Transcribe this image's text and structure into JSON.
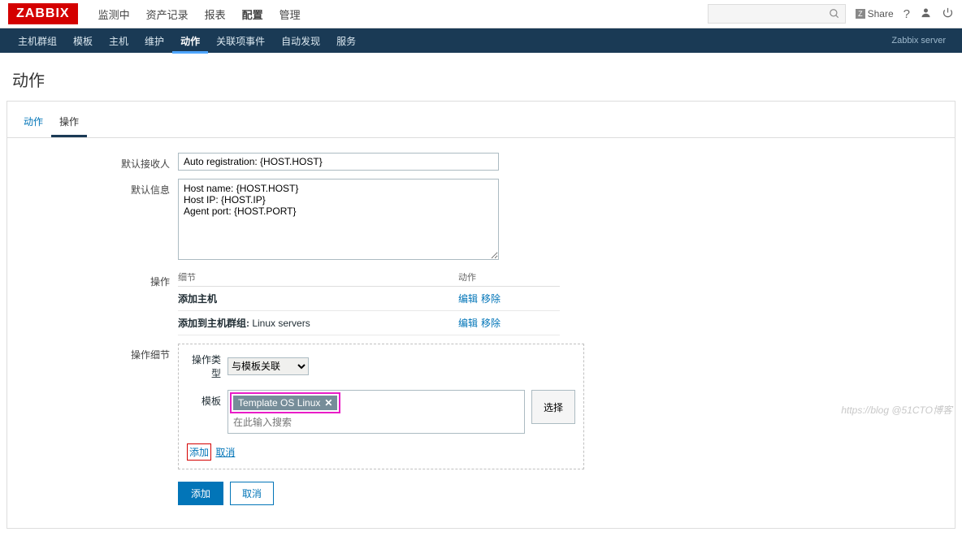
{
  "header": {
    "logo": "ZABBIX",
    "menu": [
      "监测中",
      "资产记录",
      "报表",
      "配置",
      "管理"
    ],
    "active_menu": 3,
    "share": "Share"
  },
  "subnav": {
    "items": [
      "主机群组",
      "模板",
      "主机",
      "维护",
      "动作",
      "关联项事件",
      "自动发现",
      "服务"
    ],
    "active": 4,
    "server": "Zabbix server"
  },
  "page_title": "动作",
  "tabs": {
    "tab1": "动作",
    "tab2": "操作"
  },
  "form": {
    "default_recipient_label": "默认接收人",
    "default_recipient_value": "Auto registration: {HOST.HOST}",
    "default_info_label": "默认信息",
    "default_info_value": "Host name: {HOST.HOST}\nHost IP: {HOST.IP}\nAgent port: {HOST.PORT}",
    "operations_label": "操作",
    "detail_label": "操作细节"
  },
  "operations": {
    "header_detail": "细节",
    "header_action": "动作",
    "rows": [
      {
        "text1": "添加主机",
        "text2": ""
      },
      {
        "text1": "添加到主机群组: ",
        "text2": "Linux servers"
      }
    ],
    "edit": "编辑",
    "remove": "移除"
  },
  "detail": {
    "type_label": "操作类型",
    "type_value": "与模板关联",
    "template_label": "模板",
    "template_selected": "Template OS Linux",
    "search_placeholder": "在此输入搜索",
    "select_btn": "选择",
    "add": "添加",
    "cancel": "取消"
  },
  "buttons": {
    "add": "添加",
    "cancel": "取消"
  },
  "watermark": "https://blog @51CTO博客"
}
